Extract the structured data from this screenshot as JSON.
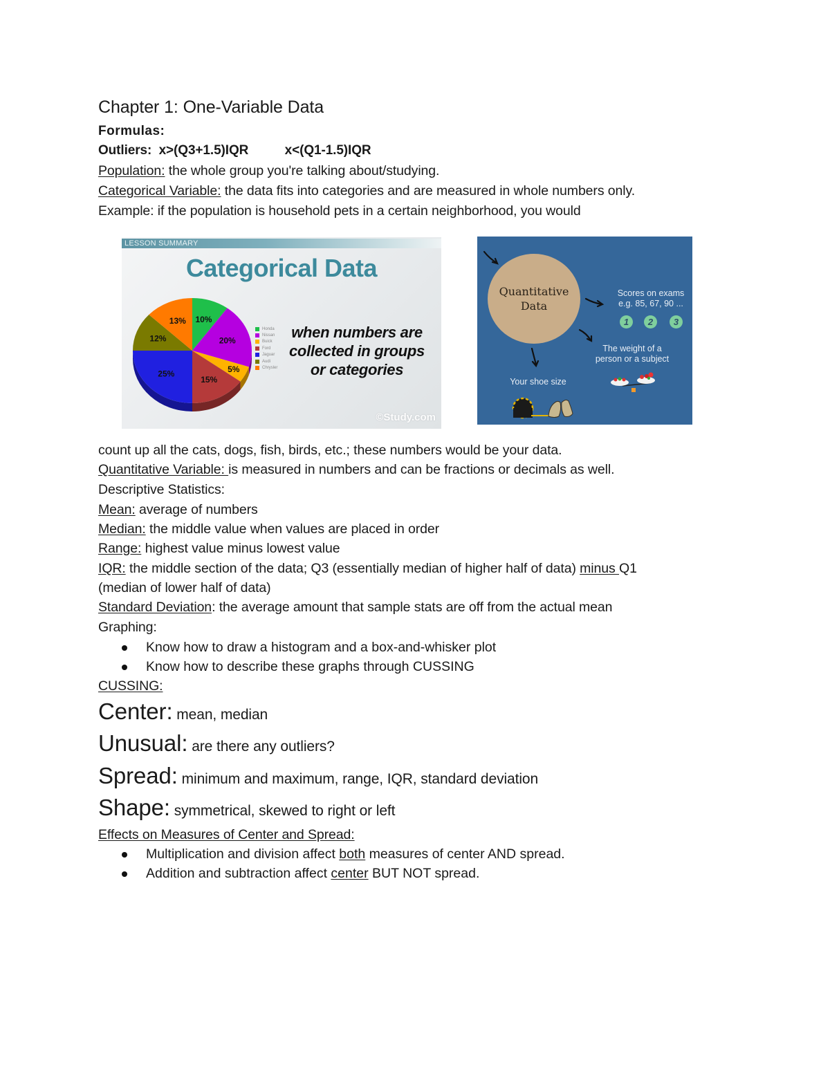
{
  "title": "Chapter 1: One-Variable Data",
  "formulas_label": "Formulas:",
  "outliers": {
    "label": "Outliers:",
    "upper": "x>(Q3+1.5)IQR",
    "lower": "x<(Q1-1.5)IQR"
  },
  "definitions": {
    "population": {
      "term": "Population:",
      "text": " the whole group you're talking about/studying."
    },
    "categorical": {
      "term": "Categorical Variable:",
      "text": " the data fits into categories and are measured in whole numbers only."
    },
    "example_1": "Example: if the population is household pets in a certain neighborhood, you would",
    "example_2": "count up all the cats, dogs, fish, birds, etc.; these numbers would be your data.",
    "quantitative": {
      "term": "Quantitative Variable: ",
      "text": "is measured in numbers and can be fractions or decimals as well."
    },
    "descriptive_stats": "Descriptive Statistics:",
    "mean": {
      "term": "Mean:",
      "text": " average of numbers"
    },
    "median": {
      "term": "Median:",
      "text": " the middle value when values are placed in order"
    },
    "range": {
      "term": "Range:",
      "text": " highest value minus lowest value"
    },
    "iqr": {
      "term": "IQR:",
      "text_1": " the middle section of the data; Q3 (essentially median of higher half of data) ",
      "minus": "minus ",
      "text_2": "Q1",
      "text_3": "(median of lower half of data)"
    },
    "std_dev": {
      "term": "Standard Deviation",
      "colon": ":",
      "text": " the average amount that sample stats are off from the actual mean"
    }
  },
  "graphing": {
    "label": "Graphing:",
    "bullets": [
      "Know how to draw a histogram and a box-and-whisker plot",
      "Know how to describe these graphs through CUSSING"
    ]
  },
  "cussing": {
    "label": "CUSSING:",
    "items": [
      {
        "term": "Center:",
        "text": " mean, median"
      },
      {
        "term": "Unusual:",
        "text": " are there any outliers?"
      },
      {
        "term": "Spread:",
        "text": " minimum and maximum, range, IQR, standard deviation"
      },
      {
        "term": "Shape:",
        "text": " symmetrical, skewed to right or left"
      }
    ]
  },
  "effects": {
    "label": "Effects on Measures of Center and Spread: ",
    "bullet_1": {
      "pre": "Multiplication and division affect ",
      "u": "both",
      "post": " measures of center AND spread."
    },
    "bullet_2": {
      "pre": "Addition and subtraction affect ",
      "u": "center",
      "post": " BUT NOT spread."
    }
  },
  "categorical_image": {
    "banner": "LESSON SUMMARY",
    "title": "Categorical Data",
    "description": [
      "when numbers are",
      "collected in groups",
      "or categories"
    ],
    "credit": "©Study.com"
  },
  "chart_data": {
    "type": "pie",
    "title": "Categorical Data",
    "categories": [
      "Honda",
      "Nissan",
      "Buick",
      "Ford",
      "Jaguar",
      "Audi",
      "Chrysler"
    ],
    "values": [
      10,
      20,
      5,
      15,
      25,
      12,
      13
    ],
    "labels": [
      "10%",
      "20%",
      "5%",
      "15%",
      "25%",
      "12%",
      "13%"
    ],
    "colors": [
      "#1fbf4a",
      "#b500e0",
      "#ffb300",
      "#b53a3a",
      "#2020e0",
      "#7a7a00",
      "#ff7a00"
    ],
    "legend": "right"
  },
  "quantitative_image": {
    "circle_title": [
      "Quantitative",
      "Data"
    ],
    "exams": [
      "Scores on exams",
      "e.g. 85, 67, 90 ..."
    ],
    "numbers": [
      "1",
      "2",
      "3"
    ],
    "weight": [
      "The weight of a",
      "person or a subject"
    ],
    "shoe": "Your shoe size",
    "circle_color": "#c9ad89",
    "background_color": "#35679a"
  }
}
